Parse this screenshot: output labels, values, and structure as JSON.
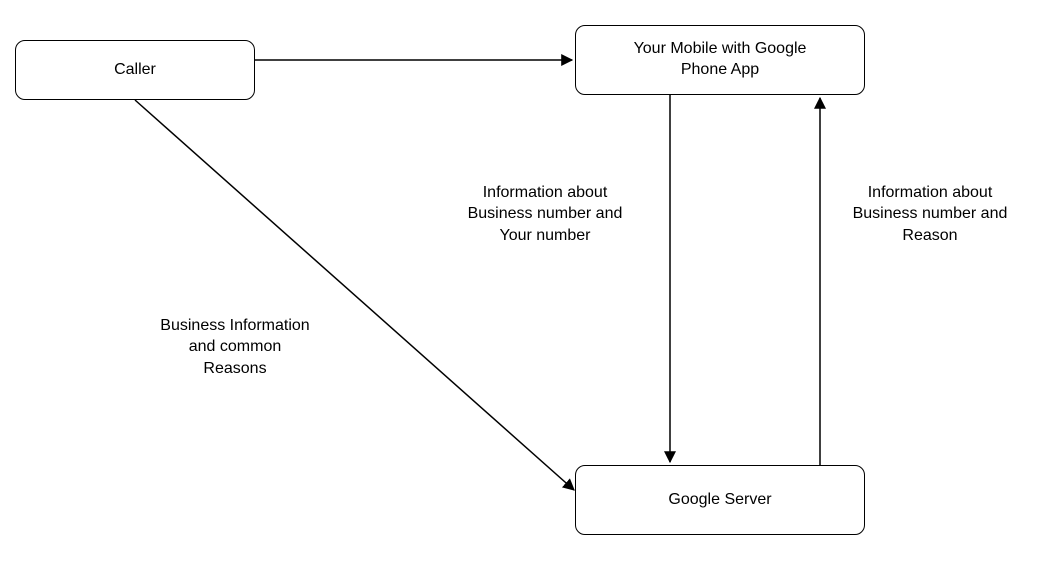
{
  "nodes": {
    "caller": {
      "label": "Caller"
    },
    "mobile": {
      "label": "Your Mobile with Google\nPhone App"
    },
    "server": {
      "label": "Google Server"
    }
  },
  "edges": {
    "caller_to_mobile": {
      "label": ""
    },
    "caller_to_server": {
      "label": "Business Information\nand common\nReasons"
    },
    "mobile_to_server": {
      "label": "Information about\nBusiness number and\nYour number"
    },
    "server_to_mobile": {
      "label": "Information about\nBusiness number and\nReason"
    }
  }
}
